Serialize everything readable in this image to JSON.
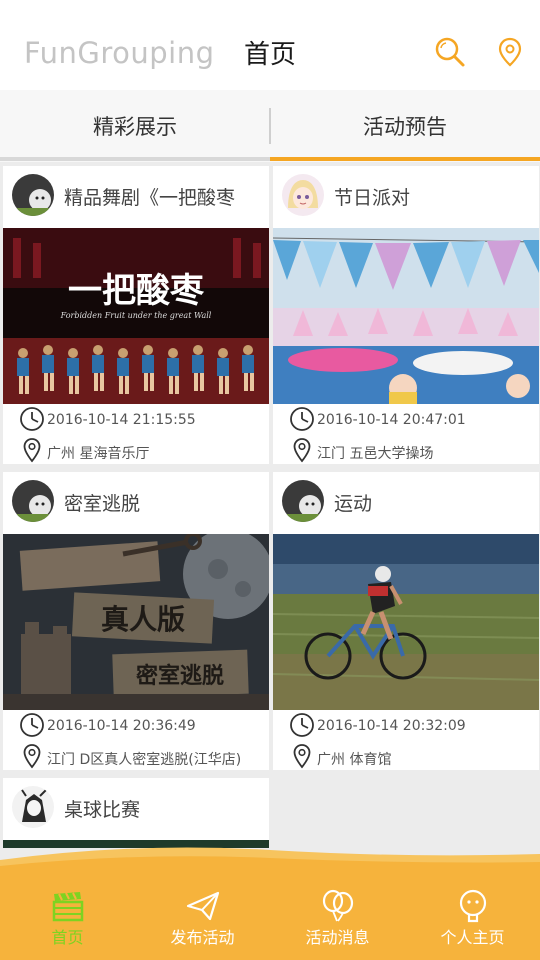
{
  "header": {
    "app_name": "FunGrouping",
    "page_title": "首页",
    "search_icon": "search-icon",
    "location_icon": "location-pin-icon",
    "accent": "#f5a623"
  },
  "tabs": [
    {
      "label": "精彩展示",
      "active": false
    },
    {
      "label": "活动预告",
      "active": true
    }
  ],
  "cards": [
    {
      "title": "精品舞剧《一把酸枣",
      "time": "2016-10-14 21:15:55",
      "location": "广州 星海音乐厅",
      "image_caption": "一把酸枣",
      "image_subcaption": "Forbidden Fruit under the great Wall"
    },
    {
      "title": "节日派对",
      "time": "2016-10-14 20:47:01",
      "location": "江门 五邑大学操场"
    },
    {
      "title": "密室逃脱",
      "time": "2016-10-14 20:36:49",
      "location": "江门 D区真人密室逃脱(江华店)",
      "image_caption": "真人版",
      "image_subcaption": "密室逃脱"
    },
    {
      "title": "运动",
      "time": "2016-10-14 20:32:09",
      "location": "广州 体育馆"
    },
    {
      "title": "桌球比赛"
    }
  ],
  "bottom_nav": [
    {
      "label": "首页",
      "icon": "clapperboard-icon",
      "active": true
    },
    {
      "label": "发布活动",
      "icon": "paper-plane-icon",
      "active": false
    },
    {
      "label": "活动消息",
      "icon": "balloons-icon",
      "active": false
    },
    {
      "label": "个人主页",
      "icon": "person-icon",
      "active": false
    }
  ],
  "colors": {
    "nav_bg": "#f6b33c",
    "nav_active": "#7ed321",
    "tab_active_underline": "#f5a623"
  }
}
